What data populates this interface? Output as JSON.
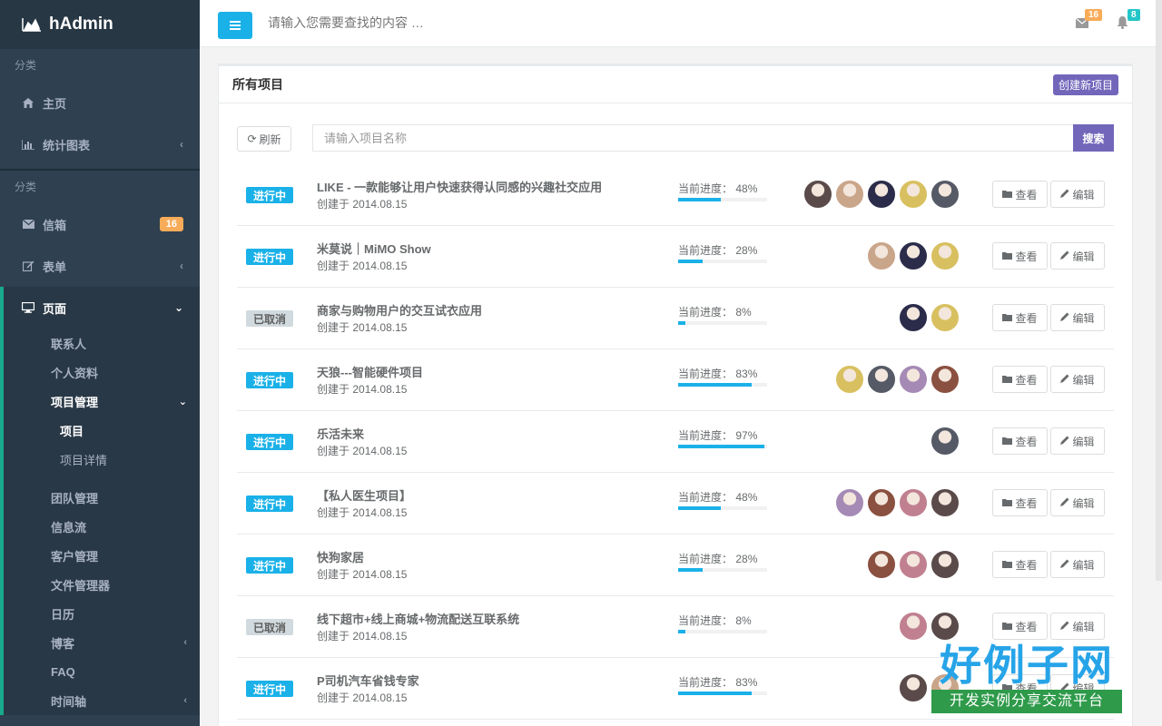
{
  "brand": {
    "name": "hAdmin"
  },
  "sidebar": {
    "section1_label": "分类",
    "section2_label": "分类",
    "home": "主页",
    "charts": "统计图表",
    "mailbox": "信箱",
    "mailbox_badge": "16",
    "forms": "表单",
    "pages": "页面",
    "pages_sub": {
      "contacts": "联系人",
      "profile": "个人资料",
      "project_mgmt": "项目管理",
      "projects": "项目",
      "project_detail": "项目详情",
      "team": "团队管理",
      "feed": "信息流",
      "clients": "客户管理",
      "file_manager": "文件管理器",
      "calendar": "日历",
      "blog": "博客",
      "faq": "FAQ",
      "timeline": "时间轴"
    }
  },
  "topbar": {
    "search_placeholder": "请输入您需要查找的内容 …",
    "mail_count": "16",
    "notif_count": "8"
  },
  "panel": {
    "title": "所有项目",
    "create_button": "创建新项目",
    "refresh_button": "刷新",
    "search_placeholder": "请输入项目名称",
    "search_button": "搜索",
    "progress_label": "当前进度：",
    "created_prefix": "创建于",
    "view_label": "查看",
    "edit_label": "编辑"
  },
  "projects": [
    {
      "status": "进行中",
      "status_type": "active",
      "title": "LIKE - 一款能够让用户快速获得认同感的兴趣社交应用",
      "date": "2014.08.15",
      "progress": "48%",
      "progress_value": 48,
      "avatars": 5
    },
    {
      "status": "进行中",
      "status_type": "active",
      "title": "米莫说｜MiMO Show",
      "date": "2014.08.15",
      "progress": "28%",
      "progress_value": 28,
      "avatars": 3
    },
    {
      "status": "已取消",
      "status_type": "cancel",
      "title": "商家与购物用户的交互试衣应用",
      "date": "2014.08.15",
      "progress": "8%",
      "progress_value": 8,
      "avatars": 2
    },
    {
      "status": "进行中",
      "status_type": "active",
      "title": "天狼---智能硬件项目",
      "date": "2014.08.15",
      "progress": "83%",
      "progress_value": 83,
      "avatars": 4
    },
    {
      "status": "进行中",
      "status_type": "active",
      "title": "乐活未来",
      "date": "2014.08.15",
      "progress": "97%",
      "progress_value": 97,
      "avatars": 1
    },
    {
      "status": "进行中",
      "status_type": "active",
      "title": "【私人医生项目】",
      "date": "2014.08.15",
      "progress": "48%",
      "progress_value": 48,
      "avatars": 4
    },
    {
      "status": "进行中",
      "status_type": "active",
      "title": "快狗家居",
      "date": "2014.08.15",
      "progress": "28%",
      "progress_value": 28,
      "avatars": 3
    },
    {
      "status": "已取消",
      "status_type": "cancel",
      "title": "线下超市+线上商城+物流配送互联系统",
      "date": "2014.08.15",
      "progress": "8%",
      "progress_value": 8,
      "avatars": 2
    },
    {
      "status": "进行中",
      "status_type": "active",
      "title": "P司机汽车省钱专家",
      "date": "2014.08.15",
      "progress": "83%",
      "progress_value": 83,
      "avatars": 2
    }
  ],
  "watermark": {
    "big": "好例子网",
    "small": "开发实例分享交流平台"
  },
  "colors": {
    "sidebar": "#2f4050",
    "accent_blue": "#1ab1e8",
    "accent_purple": "#7266ba",
    "badge_orange": "#f8ac59",
    "active_border": "#19aa8d"
  }
}
